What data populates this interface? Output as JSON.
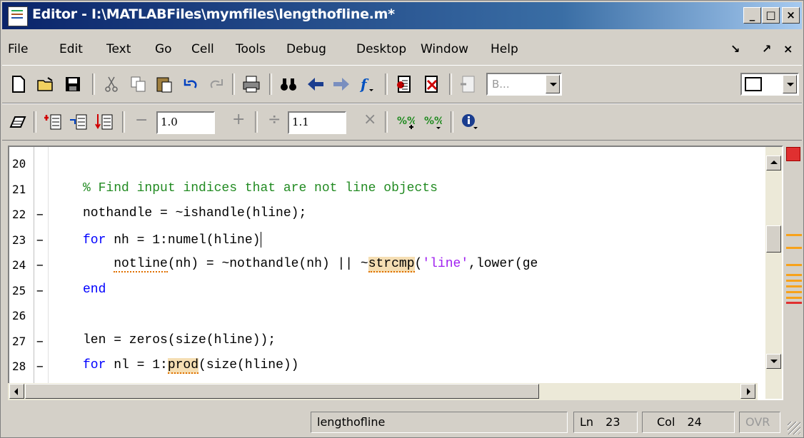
{
  "window": {
    "title": "Editor - I:\\MATLABFiles\\mymfiles\\lengthofline.m*",
    "controls": {
      "minimize": "_",
      "maximize": "□",
      "close": "×"
    }
  },
  "menubar": {
    "items": [
      "File",
      "Edit",
      "Text",
      "Go",
      "Cell",
      "Tools",
      "Debug",
      "Desktop",
      "Window",
      "Help"
    ],
    "right_dock": "↘",
    "right_undock": "↗",
    "right_close": "×"
  },
  "toolbar1": {
    "stack_combo_value": "B...",
    "overflow": "»"
  },
  "toolbar2": {
    "minus": "−",
    "decrement_value": "1.0",
    "plus": "+",
    "divide": "÷",
    "divisor_value": "1.1",
    "times": "×"
  },
  "editor": {
    "lines": [
      {
        "num": "20",
        "dash": "",
        "code": []
      },
      {
        "num": "21",
        "dash": "",
        "code": [
          {
            "t": "% Find input indices that are not line objects",
            "c": "cmt"
          }
        ]
      },
      {
        "num": "22",
        "dash": "−",
        "code": [
          {
            "t": "nothandle = ~ishandle(hline);",
            "c": ""
          }
        ]
      },
      {
        "num": "23",
        "dash": "−",
        "code": [
          {
            "t": "for",
            "c": "kw"
          },
          {
            "t": " nh = 1:numel(hline)",
            "c": ""
          }
        ],
        "caret": true
      },
      {
        "num": "24",
        "dash": "−",
        "code": [
          {
            "t": "    ",
            "c": ""
          },
          {
            "t": "notline",
            "c": "warn"
          },
          {
            "t": "(nh) = ~nothandle(nh) || ~",
            "c": ""
          },
          {
            "t": "strcmp",
            "c": "warn hl"
          },
          {
            "t": "(",
            "c": ""
          },
          {
            "t": "'line'",
            "c": "str"
          },
          {
            "t": ",lower(ge",
            "c": ""
          }
        ]
      },
      {
        "num": "25",
        "dash": "−",
        "code": [
          {
            "t": "end",
            "c": "kw"
          }
        ]
      },
      {
        "num": "26",
        "dash": "",
        "code": []
      },
      {
        "num": "27",
        "dash": "−",
        "code": [
          {
            "t": "len = zeros(size(hline));",
            "c": ""
          }
        ]
      },
      {
        "num": "28",
        "dash": "−",
        "code": [
          {
            "t": "for",
            "c": "kw"
          },
          {
            "t": " nl = 1:",
            "c": ""
          },
          {
            "t": "prod",
            "c": "warn hl"
          },
          {
            "t": "(size(hline))",
            "c": ""
          }
        ]
      }
    ]
  },
  "statusbar": {
    "filename": "lengthofline",
    "ln_label": "Ln",
    "ln_value": "23",
    "col_label": "Col",
    "col_value": "24",
    "ovr": "OVR"
  },
  "colors": {
    "comment": "#228b22",
    "keyword": "#0000ff",
    "string": "#a020f0",
    "warning_marker": "#f7a21b",
    "error_indicator": "#e03030"
  }
}
